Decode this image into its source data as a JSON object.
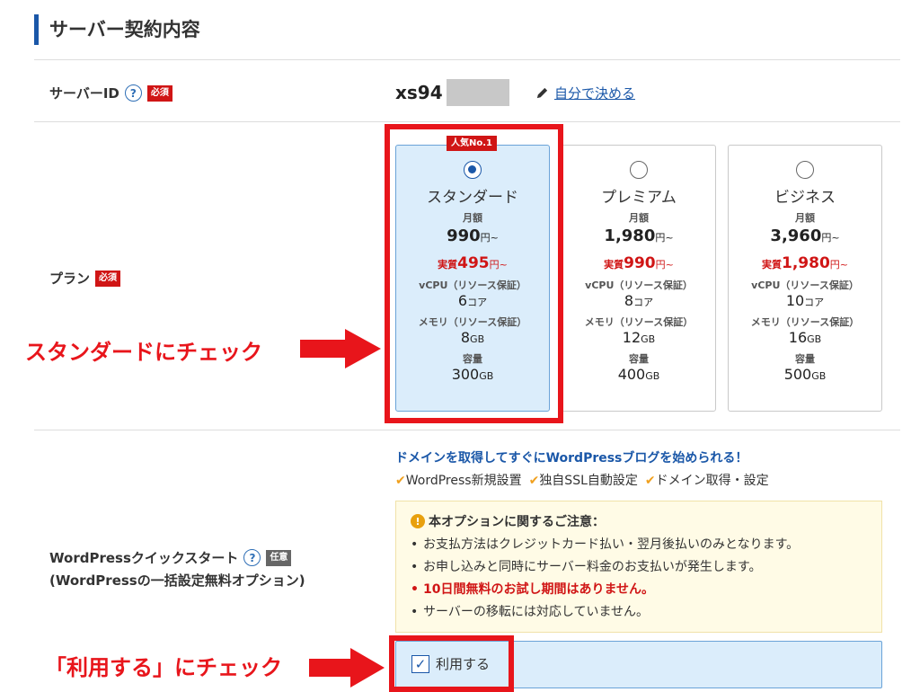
{
  "section": {
    "title": "サーバー契約内容"
  },
  "server_id": {
    "label": "サーバーID",
    "required": "必須",
    "value": "xs94",
    "self_link": "自分で決める"
  },
  "plan": {
    "label": "プラン",
    "required": "必須",
    "popular_tag": "人気No.1",
    "monthly_label": "月額",
    "real_prefix": "実質",
    "yen_from": "円~",
    "cpu_label": "vCPU（リソース保証）",
    "mem_label": "メモリ（リソース保証）",
    "capacity_label": "容量",
    "core_unit": "コア",
    "gb_unit": "GB",
    "items": [
      {
        "name": "スタンダード",
        "price": "990",
        "real": "495",
        "cpu": "6",
        "mem": "8",
        "disk": "300",
        "selected": true
      },
      {
        "name": "プレミアム",
        "price": "1,980",
        "real": "990",
        "cpu": "8",
        "mem": "12",
        "disk": "400",
        "selected": false
      },
      {
        "name": "ビジネス",
        "price": "3,960",
        "real": "1,980",
        "cpu": "10",
        "mem": "16",
        "disk": "500",
        "selected": false
      }
    ]
  },
  "annotations": {
    "standard": "スタンダードにチェック",
    "use": "「利用する」にチェック"
  },
  "wp": {
    "label": "WordPressクイックスタート",
    "optional": "任意",
    "sublabel": "(WordPressの一括設定無料オプション)",
    "promo": "ドメインを取得してすぐにWordPressブログを始められる！",
    "features": [
      "WordPress新規設置",
      "独自SSL自動設定",
      "ドメイン取得・設定"
    ],
    "notice_title": "本オプションに関するご注意：",
    "notice_items": [
      "お支払方法はクレジットカード払い・翌月後払いのみとなります。",
      "お申し込みと同時にサーバー料金のお支払いが発生します。",
      "10日間無料のお試し期間はありません。",
      "サーバーの移転には対応していません。"
    ],
    "use_label": "利用する",
    "use_checked": true
  },
  "colors": {
    "accent": "#1a57a8",
    "required": "#d01515",
    "annotation": "#e8151b",
    "selected_bg": "#dbedfb",
    "notice_bg": "#fffbe6"
  }
}
